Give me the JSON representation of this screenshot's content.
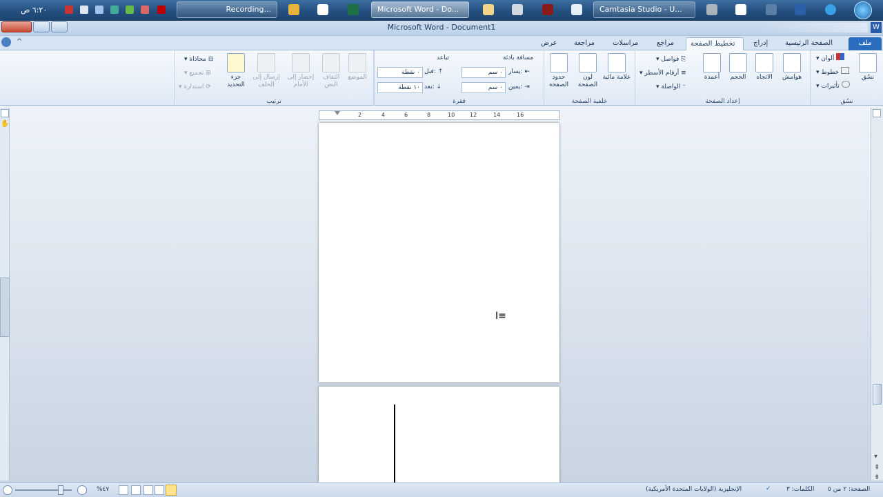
{
  "taskbar": {
    "clock": "٦:٢٠ ص",
    "buttons": [
      {
        "label": "Recording...",
        "active": false
      },
      {
        "label": "Microsoft Word - Do...",
        "active": true
      },
      {
        "label": "Camtasia Studio - U...",
        "active": false
      }
    ]
  },
  "window": {
    "title": "Microsoft Word  -  Document1"
  },
  "tabs": [
    "ملف",
    "الصفحة الرئيسية",
    "إدراج",
    "تخطيط الصفحة",
    "مراجع",
    "مراسلات",
    "مراجعة",
    "عرض"
  ],
  "ribbon": {
    "themes": {
      "label": "نسُق",
      "big": "نسُق",
      "colors": "ألوان",
      "fonts": "خطوط",
      "effects": "تأثيرات"
    },
    "page_setup": {
      "label": "إعداد الصفحة",
      "margins": "هوامش",
      "orientation": "الاتجاه",
      "size": "الحجم",
      "columns": "أعمدة",
      "breaks": "فواصل",
      "line_numbers": "أرقام الأسطر",
      "hyphenation": "الواصلة"
    },
    "page_background": {
      "label": "خلفية الصفحة",
      "watermark": "علامة مائية",
      "page_color": "لون الصفحة",
      "page_borders": "حدود الصفحة"
    },
    "paragraph": {
      "label": "فقرة",
      "indent_title": "مسافة بادئة",
      "spacing_title": "تباعد",
      "left_label": "يسار:",
      "left_value": "٠ سم",
      "right_label": "يمين:",
      "right_value": "٠ سم",
      "before_label": "قبل:",
      "before_value": "٠ نقطة",
      "after_label": "بعد:",
      "after_value": "١٠ نقطة"
    },
    "arrange": {
      "label": "ترتيب",
      "position": "الموضع",
      "wrap": "التفاف النص",
      "bring_forward": "إحضار إلى الأمام",
      "send_backward": "إرسال إلى الخلف",
      "selection_pane": "جزء التحديد",
      "align": "محاذاة",
      "group": "تجميع",
      "rotate": "استدارة"
    }
  },
  "ruler": {
    "ticks": [
      "2",
      "4",
      "6",
      "8",
      "10",
      "12",
      "14",
      "16"
    ]
  },
  "statusbar": {
    "page": "الصفحة: ٢ من ٥",
    "words": "الكلمات: ٣",
    "language": "الإنجليزية (الولايات المتحدة الأمريكية)",
    "zoom": "%٤٧"
  },
  "colors": {
    "accent": "#2a6cbf",
    "taskbar": "#24507f"
  }
}
